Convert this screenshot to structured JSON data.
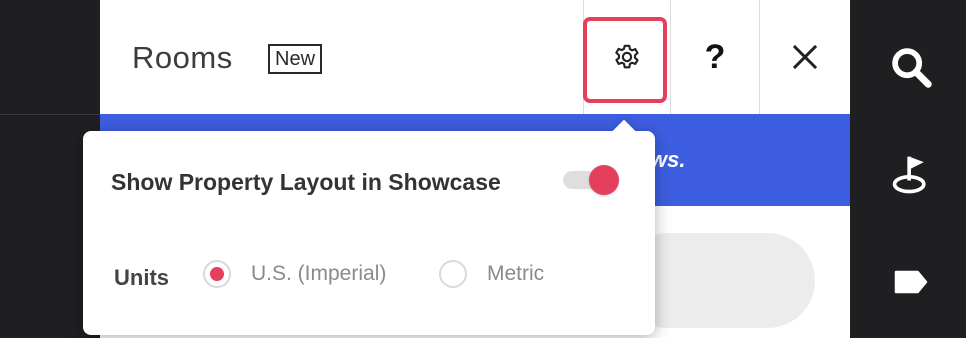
{
  "panel": {
    "title": "Rooms",
    "badge": "New",
    "help_label": "?"
  },
  "banner": {
    "text_fragment": "ws."
  },
  "popover": {
    "toggle_label": "Show Property Layout in Showcase",
    "toggle_on": true,
    "units_label": "Units",
    "unit_options": [
      "U.S. (Imperial)",
      "Metric"
    ],
    "selected_unit": "U.S. (Imperial)"
  },
  "icons": {
    "settings": "gear-icon",
    "close": "close-icon",
    "search": "search-icon",
    "flag": "flag-marker-icon",
    "tag": "tag-icon"
  },
  "colors": {
    "accent": "#e4405e",
    "banner_blue": "#3d5ee0",
    "sidebar_dark": "#1f1f22"
  }
}
